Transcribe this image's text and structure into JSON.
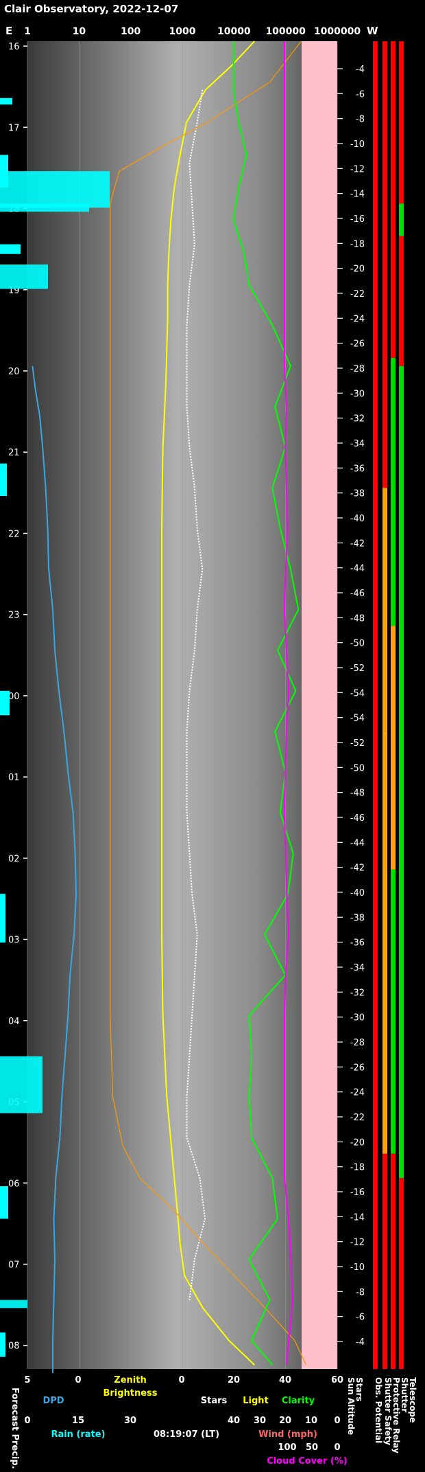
{
  "chart_data": {
    "type": "line",
    "title": "Clair Observatory, 2022-12-07",
    "timestamp": "08:19:07 (LT)",
    "top_axis": {
      "scale": "log",
      "tick_labels": [
        "1",
        "10",
        "100",
        "1000",
        "10000",
        "100000",
        "1000000"
      ],
      "corner_left": "E",
      "corner_right": "W"
    },
    "hour_labels": [
      "16",
      "17",
      "18",
      "19",
      "20",
      "21",
      "22",
      "23",
      "00",
      "01",
      "02",
      "03",
      "04",
      "05",
      "06",
      "07",
      "08"
    ],
    "sun_altitude_ticks": [
      "-4",
      "-6",
      "-8",
      "-10",
      "-12",
      "-14",
      "-16",
      "-18",
      "-20",
      "-22",
      "-24",
      "-26",
      "-28",
      "-30",
      "-32",
      "-34",
      "-36",
      "-38",
      "-40",
      "-42",
      "-44",
      "-46",
      "-48",
      "-50",
      "-52",
      "-54",
      "-54",
      "-52",
      "-50",
      "-48",
      "-46",
      "-44",
      "-42",
      "-40",
      "-38",
      "-36",
      "-34",
      "-32",
      "-30",
      "-28",
      "-26",
      "-24",
      "-22",
      "-20",
      "-18",
      "-16",
      "-14",
      "-12",
      "-10",
      "-8",
      "-6",
      "-4"
    ],
    "bottom_axes": {
      "dpd": {
        "label": "DPD",
        "ticks": [
          "5",
          "0"
        ],
        "color": "#3aa6e0"
      },
      "zenith": {
        "label_line1": "Zenith",
        "label_line2": "Brightness",
        "color": "#ffff00"
      },
      "rain": {
        "label": "Rain (rate)",
        "ticks": [
          "0",
          "15",
          "30"
        ],
        "color": "#00ffff"
      },
      "stars": {
        "label": "Stars",
        "color": "#ffffff"
      },
      "light": {
        "label": "Light",
        "color": "#ffff00"
      },
      "clarity": {
        "label": "Clarity",
        "color": "#00ff00"
      },
      "upper_ticks": [
        "0",
        "20",
        "40",
        "60"
      ],
      "wind": {
        "label": "Wind (mph)",
        "ticks": [
          "40",
          "30",
          "20",
          "10",
          "0"
        ],
        "color": "#ff6666"
      },
      "cloud": {
        "label": "Cloud Cover (%)",
        "ticks": [
          "100",
          "50",
          "0"
        ],
        "color": "#ff00ff"
      }
    },
    "side_labels": {
      "forecast": "Forecast Precip.",
      "columns": [
        "Sun Altitude",
        "Stars",
        "Obs. Potential",
        "Shutter Safety",
        "Protective Relay",
        "Shutter",
        "Telescope"
      ]
    },
    "series": [
      {
        "name": "DPD",
        "color": "#3aa6e0",
        "hours": [
          0,
          3.8,
          4.0,
          4.3,
          4.6,
          5.0,
          5.5,
          6.0,
          6.5,
          7.0,
          7.5,
          8.0,
          8.5,
          9.0,
          9.5,
          10.0,
          10.5,
          11.0,
          11.5,
          12.0,
          12.5,
          13.0,
          13.5,
          14.0,
          14.5,
          15.0,
          15.5,
          16.0,
          16.4
        ],
        "values": [
          null,
          null,
          4.5,
          4.2,
          3.8,
          3.5,
          3.2,
          3.0,
          2.9,
          2.5,
          2.3,
          1.9,
          1.4,
          1.0,
          0.5,
          0.3,
          0.2,
          0.4,
          0.8,
          1.0,
          1.3,
          1.6,
          1.8,
          2.2,
          2.4,
          2.3,
          2.4,
          2.5,
          2.5
        ]
      },
      {
        "name": "Zenith Brightness",
        "color": "#ffff00",
        "hours": [
          0,
          0.3,
          0.6,
          1.0,
          1.4,
          1.8,
          2.2,
          2.6,
          3.0,
          3.4,
          3.8,
          4.2,
          4.6,
          5.0,
          6.0,
          7.0,
          8.0,
          9.0,
          10.0,
          11.0,
          12.0,
          13.0,
          14.0,
          14.4,
          14.8,
          15.2,
          15.6,
          16.0,
          16.3
        ],
        "values": [
          25000,
          9000,
          2800,
          1200,
          900,
          700,
          600,
          550,
          520,
          520,
          500,
          480,
          450,
          420,
          400,
          400,
          400,
          400,
          400,
          400,
          420,
          500,
          700,
          800,
          900,
          1100,
          2500,
          8000,
          25000
        ]
      },
      {
        "name": "Stars",
        "color": "#ffffff",
        "hours": [
          0.6,
          1.0,
          1.5,
          2.0,
          2.5,
          3.0,
          3.5,
          4.0,
          4.5,
          5.0,
          5.5,
          6.0,
          6.5,
          7.0,
          7.5,
          8.0,
          8.5,
          9.0,
          9.5,
          10.0,
          10.5,
          11.0,
          11.5,
          12.0,
          12.5,
          13.0,
          13.5,
          14.0,
          14.5,
          15.0,
          15.5
        ],
        "values": [
          8,
          6,
          3,
          4,
          5,
          3,
          2,
          2,
          2,
          3,
          5,
          6,
          8,
          6,
          5,
          3,
          2,
          2,
          2,
          3,
          4,
          6,
          5,
          4,
          3,
          2,
          2,
          7,
          9,
          5,
          3
        ]
      },
      {
        "name": "Light",
        "color": "#ff9900",
        "hours": [
          0,
          0.5,
          1.0,
          1.3,
          1.6,
          2.0,
          3.0,
          4.0,
          6.0,
          8.0,
          10.0,
          12.0,
          13.0,
          13.6,
          14.0,
          14.4,
          14.8,
          15.2,
          15.6,
          16.0,
          16.3
        ],
        "values": [
          200000,
          50000,
          3000,
          400,
          60,
          40,
          40,
          40,
          40,
          40,
          40,
          40,
          45,
          70,
          150,
          700,
          2500,
          10000,
          40000,
          150000,
          250000
        ]
      },
      {
        "name": "Clarity",
        "color": "#00ff00",
        "hours": [
          0,
          0.3,
          0.6,
          1.0,
          1.4,
          1.8,
          2.2,
          2.6,
          3.0,
          3.5,
          4.0,
          4.5,
          5.0,
          5.5,
          6.0,
          6.5,
          7.0,
          7.5,
          8.0,
          8.5,
          9.0,
          9.5,
          10.0,
          10.5,
          11.0,
          11.5,
          12.0,
          12.5,
          13.0,
          13.5,
          14.0,
          14.5,
          15.0,
          15.5,
          16.0,
          16.3
        ],
        "values": [
          20,
          20,
          20,
          22,
          25,
          22,
          20,
          24,
          26,
          35,
          42,
          36,
          40,
          35,
          38,
          42,
          45,
          37,
          44,
          36,
          40,
          38,
          43,
          41,
          32,
          40,
          26,
          27,
          26,
          27,
          35,
          37,
          26,
          34,
          27,
          35
        ]
      },
      {
        "name": "Cloud Cover",
        "color": "#ff00ff",
        "hours": [
          0,
          0.3,
          4.0,
          4.5,
          5.0,
          5.5,
          6.0,
          6.5,
          7.0,
          7.5,
          8.0,
          8.5,
          9.0,
          9.5,
          10.0,
          10.5,
          11.0,
          11.5,
          12.0,
          14.0,
          14.5,
          15.0,
          15.5,
          16.0,
          16.3
        ],
        "values": [
          0,
          0,
          0,
          5,
          2,
          5,
          8,
          3,
          0,
          5,
          10,
          5,
          2,
          0,
          3,
          6,
          10,
          3,
          0,
          0,
          10,
          15,
          20,
          10,
          5
        ]
      }
    ],
    "status_colors": {
      "bad": "#ff0000",
      "good": "#00dd00",
      "marginal": "#ffa500",
      "cloud_fill": "#ffc0cb"
    }
  }
}
